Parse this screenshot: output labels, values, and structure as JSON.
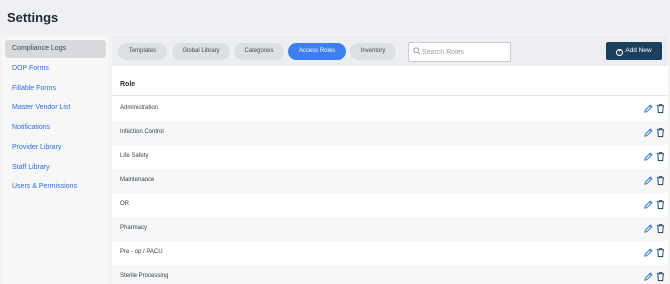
{
  "page": {
    "title": "Settings"
  },
  "sidebar": {
    "items": [
      {
        "label": "Compliance Logs",
        "active": true
      },
      {
        "label": "DOP Forms"
      },
      {
        "label": "Fillable Forms"
      },
      {
        "label": "Master Vendor List"
      },
      {
        "label": "Notifications"
      },
      {
        "label": "Provider Library"
      },
      {
        "label": "Staff Library"
      },
      {
        "label": "Users & Permissions"
      }
    ]
  },
  "toolbar": {
    "tabs": [
      {
        "label": "Templates"
      },
      {
        "label": "Global Library"
      },
      {
        "label": "Categories"
      },
      {
        "label": "Access Roles",
        "active": true
      },
      {
        "label": "Inventory"
      }
    ],
    "search_placeholder": "Search Roles",
    "search_value": "",
    "add_label": "Add New"
  },
  "table": {
    "column": "Role",
    "rows": [
      "Administration",
      "Infection Control",
      "Life Safety",
      "Maintenance",
      "OR",
      "Pharmacy",
      "Pre - op / PACU",
      "Sterile Processing"
    ]
  },
  "colors": {
    "accent": "#3b7ff0",
    "primary_button": "#1d3f5e",
    "link": "#2f6fde",
    "action_icon": "#2f6fde",
    "delete_icon": "#1d3f5e"
  }
}
